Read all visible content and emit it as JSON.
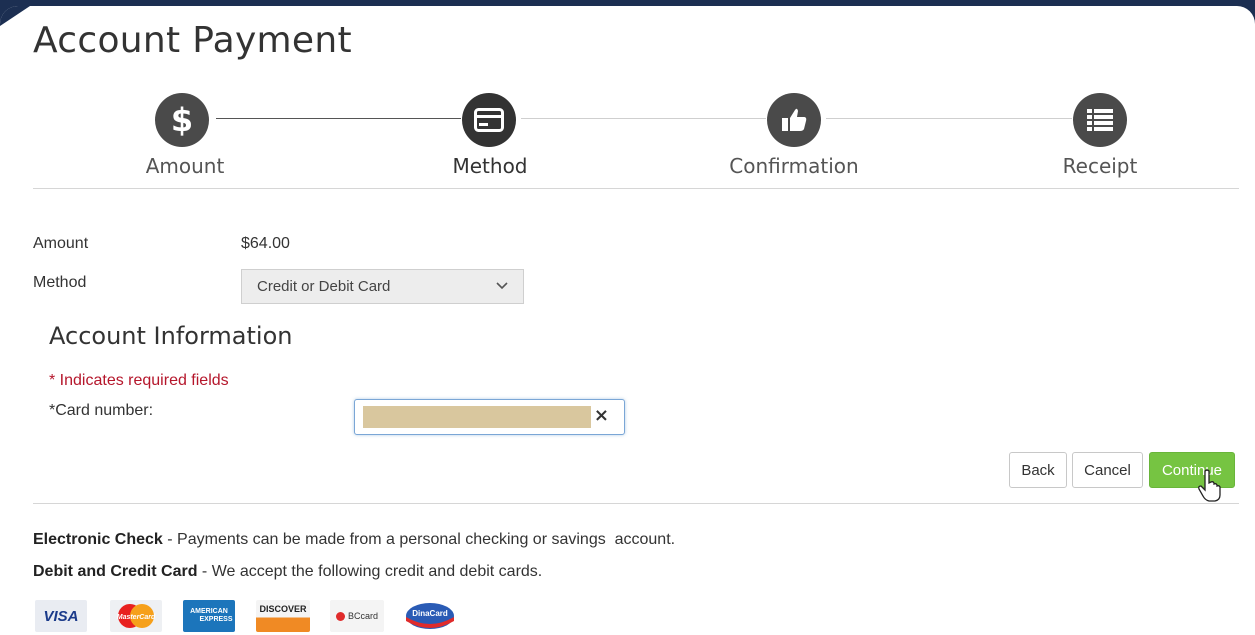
{
  "page": {
    "title": "Account Payment"
  },
  "stepper": {
    "steps": [
      {
        "label": "Amount",
        "icon": "dollar-icon"
      },
      {
        "label": "Method",
        "icon": "credit-card-icon"
      },
      {
        "label": "Confirmation",
        "icon": "thumbs-up-icon"
      },
      {
        "label": "Receipt",
        "icon": "list-icon"
      }
    ],
    "current": "Method"
  },
  "form": {
    "amount_label": "Amount",
    "amount_value": "$64.00",
    "method_label": "Method",
    "method_selected": "Credit or Debit Card"
  },
  "account_info": {
    "title": "Account Information",
    "required_note": "* Indicates required fields",
    "card_number_label": "*Card number:",
    "clear_symbol": "×"
  },
  "buttons": {
    "back": "Back",
    "cancel": "Cancel",
    "continue": "Continue"
  },
  "info": {
    "echeck_title": "Electronic Check",
    "echeck_text": " - Payments can be made from a personal checking or savings  account.",
    "card_title": "Debit and Credit Card",
    "card_text": " - We accept the following credit and debit cards."
  },
  "card_logos": {
    "visa": "VISA",
    "mastercard": "MasterCard",
    "amex_line1": "AMERICAN",
    "amex_line2": "EXPRESS",
    "discover": "DISCOVER",
    "bccard": "BCcard",
    "dinacard": "DinaCard"
  },
  "colors": {
    "primary_button": "#76c442",
    "required_text": "#b5162b",
    "step_circle": "#4a4a4a",
    "window_frame": "#1c2f52"
  }
}
